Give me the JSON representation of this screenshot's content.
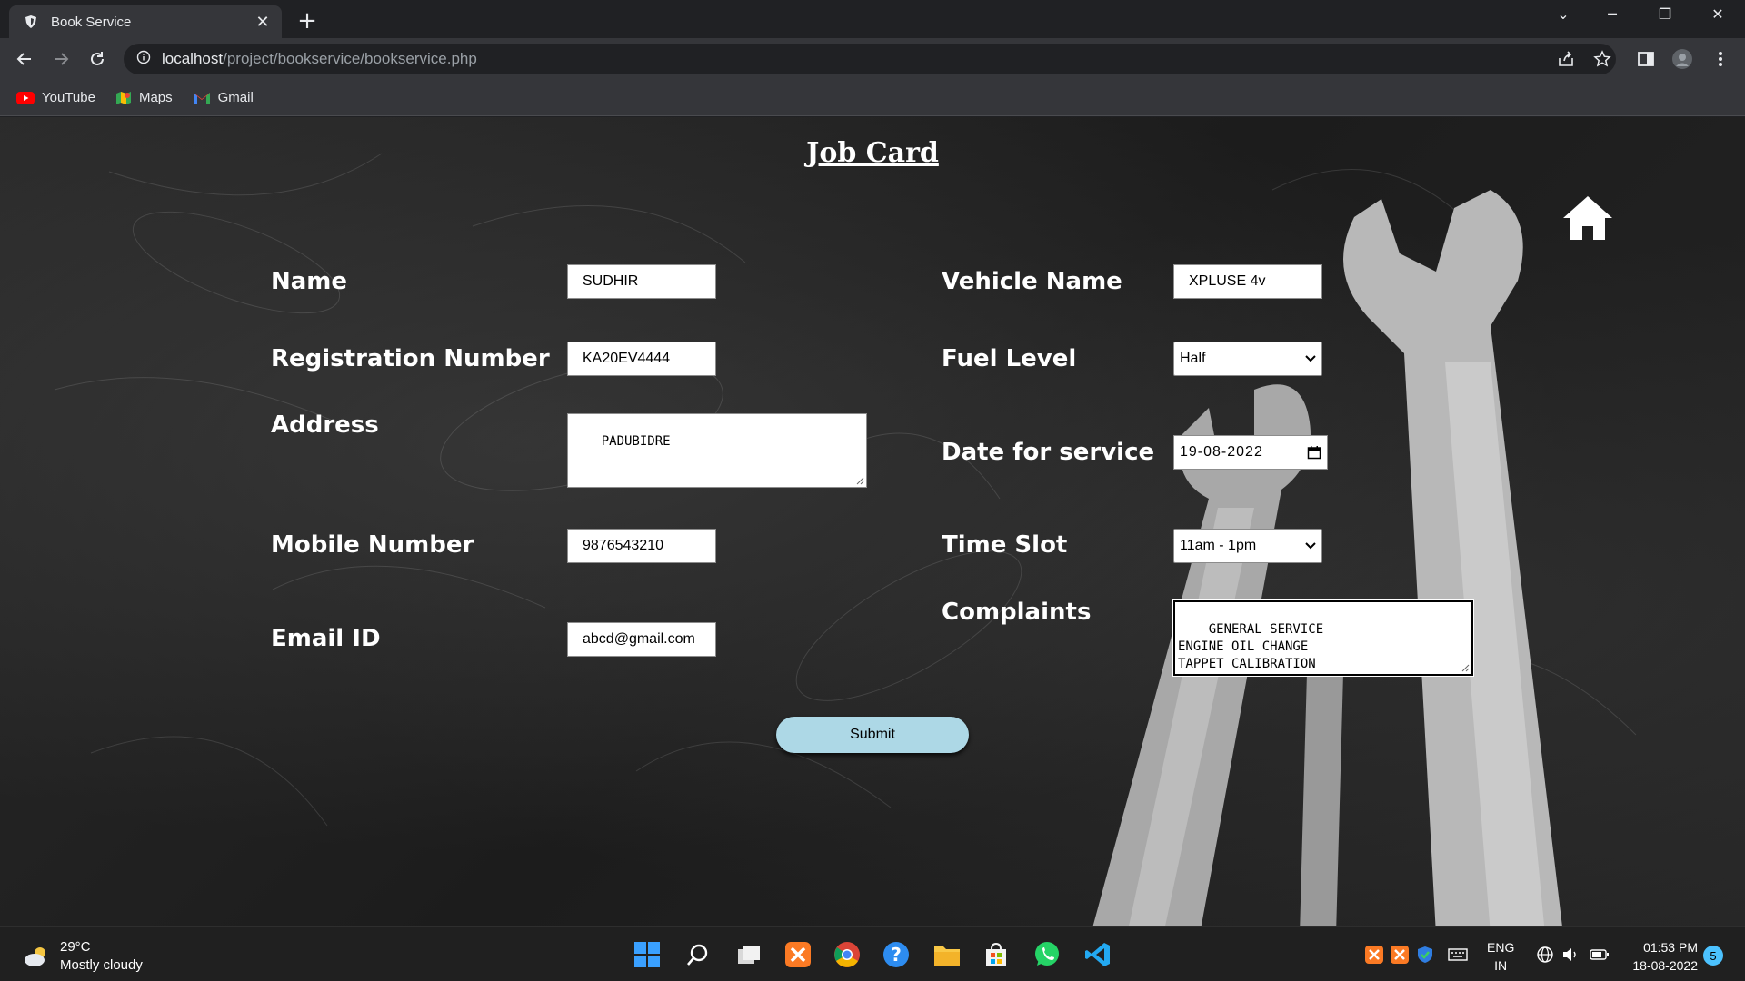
{
  "browser": {
    "tab_title": "Book Service",
    "url_host": "localhost",
    "url_path": "/project/bookservice/bookservice.php",
    "bookmarks": [
      {
        "label": "YouTube",
        "icon": "youtube-icon"
      },
      {
        "label": "Maps",
        "icon": "maps-icon"
      },
      {
        "label": "Gmail",
        "icon": "gmail-icon"
      }
    ]
  },
  "page": {
    "title": "Job Card",
    "form": {
      "name_label": "Name",
      "name_value": "SUDHIR",
      "reg_label": "Registration Number",
      "reg_value": "KA20EV4444",
      "address_label": "Address",
      "address_value": "PADUBIDRE",
      "mobile_label": "Mobile Number",
      "mobile_value": "9876543210",
      "email_label": "Email ID",
      "email_value": "abcd@gmail.com",
      "vehicle_label": "Vehicle Name",
      "vehicle_value": "XPLUSE 4v",
      "fuel_label": "Fuel Level",
      "fuel_value": "Half",
      "date_label": "Date for service",
      "date_value": "19-08-2022",
      "slot_label": "Time Slot",
      "slot_value": "11am - 1pm",
      "complaints_label": "Complaints",
      "complaints_value": "GENERAL SERVICE\nENGINE OIL CHANGE\nTAPPET CALIBRATION\nWASH",
      "submit_label": "Submit"
    }
  },
  "taskbar": {
    "temperature": "29°C",
    "weather": "Mostly cloudy",
    "lang_top": "ENG",
    "lang_bottom": "IN",
    "time": "01:53 PM",
    "date": "18-08-2022",
    "notifications": "5"
  },
  "colors": {
    "submit_bg": "#add8e6",
    "page_bg": "#222222",
    "accent": "#4cc2ff"
  }
}
